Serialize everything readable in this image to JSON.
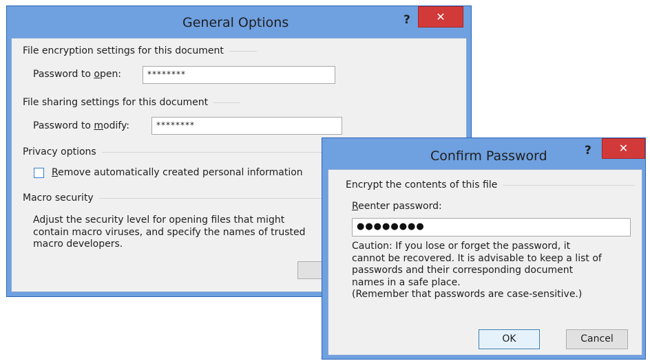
{
  "general": {
    "title": "General Options",
    "help_label": "?",
    "close_label": "✕",
    "encryption_heading": "File encryption settings for this document",
    "open_label_pre": "Password to ",
    "open_label_key": "o",
    "open_label_post": "pen:",
    "open_value": "********",
    "sharing_heading": "File sharing settings for this document",
    "modify_label_pre": "Password to ",
    "modify_label_key": "m",
    "modify_label_post": "odify:",
    "modify_value": "********",
    "privacy_heading": "Privacy options",
    "remove_label_key": "R",
    "remove_label_rest": "emove automatically created personal information",
    "macro_heading": "Macro security",
    "macro_line1": "Adjust the security level for opening files that might",
    "macro_line2": "contain macro viruses, and specify the names of trusted",
    "macro_line3": "macro developers."
  },
  "confirm": {
    "title": "Confirm Password",
    "help_label": "?",
    "close_label": "✕",
    "heading": "Encrypt the contents of this file",
    "reenter_key": "R",
    "reenter_rest": "eenter password:",
    "password_value": "●●●●●●●●",
    "caution_line1": "Caution: If you lose or forget the password, it",
    "caution_line2": "cannot be recovered. It is advisable to keep a list of",
    "caution_line3": "passwords and their corresponding document",
    "caution_line4": "names in a safe place.",
    "caution_line5": "(Remember that passwords are case-sensitive.)",
    "ok_label": "OK",
    "cancel_label": "Cancel"
  }
}
